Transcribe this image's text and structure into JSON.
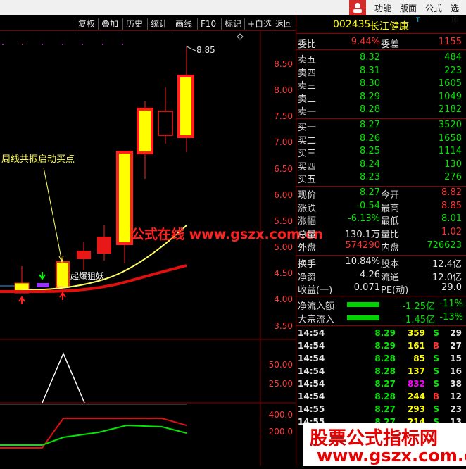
{
  "topmenu": [
    "功能",
    "版面",
    "公式",
    "选项"
  ],
  "toolbar": [
    "复权",
    "叠加",
    "历史",
    "统计",
    "画线",
    "F10",
    "标记",
    "+自选",
    "返回"
  ],
  "stock": {
    "code": "002435",
    "name": "长江健康",
    "t_mark": "T"
  },
  "weibi": {
    "label": "委比",
    "pct": "9.44%",
    "diff_label": "委差",
    "diff": "1155"
  },
  "asks": [
    {
      "label": "卖五",
      "price": "8.32",
      "vol": "484"
    },
    {
      "label": "卖四",
      "price": "8.31",
      "vol": "223"
    },
    {
      "label": "卖三",
      "price": "8.30",
      "vol": "1605"
    },
    {
      "label": "卖二",
      "price": "8.29",
      "vol": "1049"
    },
    {
      "label": "卖一",
      "price": "8.28",
      "vol": "2182"
    }
  ],
  "bids": [
    {
      "label": "买一",
      "price": "8.27",
      "vol": "3520"
    },
    {
      "label": "买二",
      "price": "8.26",
      "vol": "1658"
    },
    {
      "label": "买三",
      "price": "8.25",
      "vol": "1114"
    },
    {
      "label": "买四",
      "price": "8.24",
      "vol": "130"
    },
    {
      "label": "买五",
      "price": "8.23",
      "vol": "276"
    }
  ],
  "stats": [
    {
      "l1": "现价",
      "v1": "8.27",
      "l2": "今开",
      "v2": "8.82"
    },
    {
      "l1": "涨跌",
      "v1": "-0.54",
      "l2": "最高",
      "v2": "8.85"
    },
    {
      "l1": "涨幅",
      "v1": "-6.13%",
      "l2": "最低",
      "v2": "8.01"
    },
    {
      "l1": "总量",
      "v1": "130.1万",
      "l2": "量比",
      "v2": "1.02"
    },
    {
      "l1": "外盘",
      "v1": "574290",
      "l2": "内盘",
      "v2": "726623"
    }
  ],
  "stats2": [
    {
      "l1": "换手",
      "v1": "10.84%",
      "l2": "股本",
      "v2": "12.4亿"
    },
    {
      "l1": "净资",
      "v1": "4.26",
      "l2": "流通",
      "v2": "12.0亿"
    },
    {
      "l1": "收益(一)",
      "v1": "0.071",
      "l2": "PE(动)",
      "v2": "29.0"
    }
  ],
  "flows": [
    {
      "label": "净流入额",
      "amt": "-1.25亿",
      "pct": "-11%"
    },
    {
      "label": "大宗流入",
      "amt": "-1.45亿",
      "pct": "-13%"
    }
  ],
  "ticks": [
    {
      "time": "14:54",
      "price": "8.29",
      "vol": "359",
      "side": "S",
      "n": "29"
    },
    {
      "time": "14:54",
      "price": "8.29",
      "vol": "161",
      "side": "B",
      "n": "27"
    },
    {
      "time": "14:54",
      "price": "8.28",
      "vol": "85",
      "side": "S",
      "n": "15"
    },
    {
      "time": "14:54",
      "price": "8.28",
      "vol": "137",
      "side": "S",
      "n": "16"
    },
    {
      "time": "14:54",
      "price": "8.27",
      "vol": "832",
      "side": "S",
      "n": "38"
    },
    {
      "time": "14:54",
      "price": "8.28",
      "vol": "244",
      "side": "B",
      "n": "12"
    },
    {
      "time": "14:55",
      "price": "8.27",
      "vol": "293",
      "side": "S",
      "n": "23"
    },
    {
      "time": "14:55",
      "price": "8.27",
      "vol": "214",
      "side": "S",
      "n": "13"
    }
  ],
  "price_axis": [
    "8.50",
    "8.00",
    "7.50",
    "7.00",
    "6.50",
    "6.00",
    "5.50",
    "5.00",
    "4.50",
    "4.00",
    "3.50"
  ],
  "ind1_axis": [
    "50.00",
    "25.00"
  ],
  "ind2_axis": [
    "400.0",
    "200.0"
  ],
  "high_label": "8.85",
  "annotation": "周线共振启动买点",
  "annotation2": "起爆狙妖",
  "watermark": "公式在线 www.gszx.com.cn",
  "banner": {
    "title": "股票公式指标网",
    "url": "www.gszx.com.cn"
  },
  "colors": {
    "up": "#ff3232",
    "down": "#00e600",
    "separator": "#8b0000"
  }
}
